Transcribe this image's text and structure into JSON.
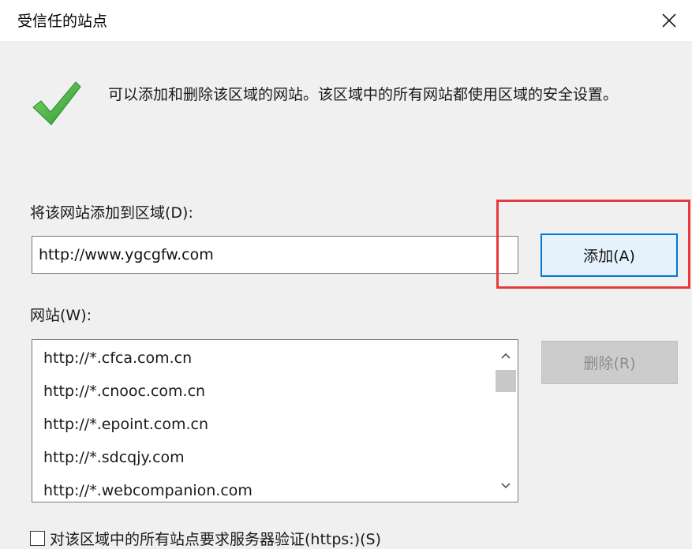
{
  "window": {
    "title": "受信任的站点",
    "close_icon": "close-icon"
  },
  "info": {
    "icon": "green-check-icon",
    "text": "可以添加和删除该区域的网站。该区域中的所有网站都使用区域的安全设置。"
  },
  "add_section": {
    "label": "将该网站添加到区域(D):",
    "input_value": "http://www.ygcgfw.com",
    "add_button": "添加(A)"
  },
  "sites_section": {
    "label": "网站(W):",
    "items": [
      "http://*.cfca.com.cn",
      "http://*.cnooc.com.cn",
      "http://*.epoint.com.cn",
      "http://*.sdcqjy.com",
      "http://*.webcompanion.com"
    ],
    "remove_button": "删除(R)"
  },
  "require_https": {
    "label": "对该区域中的所有站点要求服务器验证(https:)(S)",
    "checked": false
  },
  "colors": {
    "highlight": "#e8393b",
    "add_button_border": "#0078d7",
    "add_button_bg": "#e5f1fb"
  }
}
